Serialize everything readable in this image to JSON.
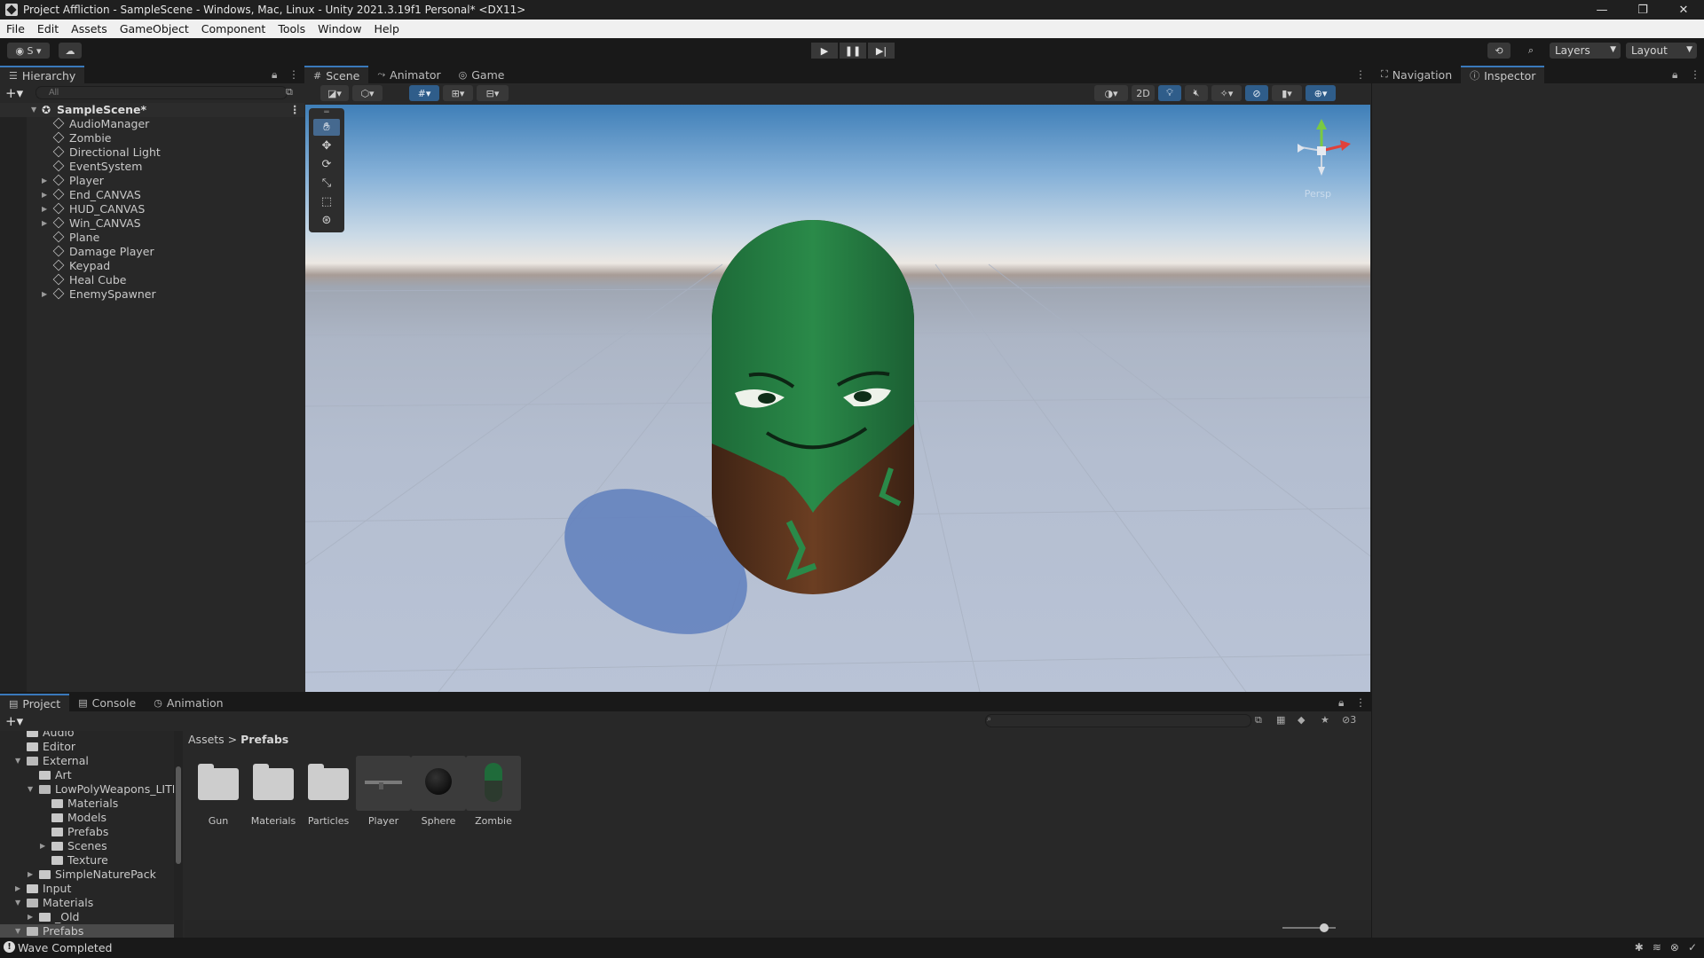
{
  "window": {
    "title": "Project Affliction - SampleScene - Windows, Mac, Linux - Unity 2021.3.19f1 Personal* <DX11>",
    "controls": [
      "—",
      "❐",
      "✕"
    ]
  },
  "menu": [
    "File",
    "Edit",
    "Assets",
    "GameObject",
    "Component",
    "Tools",
    "Window",
    "Help"
  ],
  "toolbar": {
    "account_label": "S",
    "layers_label": "Layers",
    "layout_label": "Layout"
  },
  "hierarchy": {
    "tab_label": "Hierarchy",
    "search_placeholder": "All",
    "scene_name": "SampleScene*",
    "items": [
      {
        "label": "AudioManager",
        "expandable": false
      },
      {
        "label": "Zombie",
        "expandable": false
      },
      {
        "label": "Directional Light",
        "expandable": false
      },
      {
        "label": "EventSystem",
        "expandable": false
      },
      {
        "label": "Player",
        "expandable": true
      },
      {
        "label": "End_CANVAS",
        "expandable": true
      },
      {
        "label": "HUD_CANVAS",
        "expandable": true
      },
      {
        "label": "Win_CANVAS",
        "expandable": true
      },
      {
        "label": "Plane",
        "expandable": false
      },
      {
        "label": "Damage Player",
        "expandable": false
      },
      {
        "label": "Keypad",
        "expandable": false
      },
      {
        "label": "Heal Cube",
        "expandable": false
      },
      {
        "label": "EnemySpawner",
        "expandable": true
      }
    ]
  },
  "scene_tabs": [
    {
      "label": "Scene",
      "icon": "#",
      "active": true
    },
    {
      "label": "Animator",
      "icon": "⤳",
      "active": false
    },
    {
      "label": "Game",
      "icon": "◎",
      "active": false
    }
  ],
  "scene_toolbar": {
    "mode_2d_label": "2D"
  },
  "scene_view": {
    "persp_label": "Persp",
    "gizmo_axes": {
      "y_color": "#7ac943",
      "x_color": "#e0413a",
      "z_color": "#4a7fd8"
    }
  },
  "right_tabs": [
    {
      "label": "Navigation",
      "icon": "⛶",
      "active": false
    },
    {
      "label": "Inspector",
      "icon": "ⓘ",
      "active": true
    }
  ],
  "bottom_tabs": [
    {
      "label": "Project",
      "icon": "▤",
      "active": true
    },
    {
      "label": "Console",
      "icon": "▤",
      "active": false
    },
    {
      "label": "Animation",
      "icon": "◷",
      "active": false
    }
  ],
  "project": {
    "search_value": "",
    "hidden_count": "3",
    "tree": [
      {
        "label": "Audio",
        "indent": 1,
        "arrow": "",
        "selected": false
      },
      {
        "label": "Editor",
        "indent": 1,
        "arrow": "",
        "selected": false
      },
      {
        "label": "External",
        "indent": 1,
        "arrow": "▼",
        "selected": false
      },
      {
        "label": "Art",
        "indent": 2,
        "arrow": "",
        "selected": false
      },
      {
        "label": "LowPolyWeapons_LITE",
        "indent": 2,
        "arrow": "▼",
        "selected": false
      },
      {
        "label": "Materials",
        "indent": 3,
        "arrow": "",
        "selected": false
      },
      {
        "label": "Models",
        "indent": 3,
        "arrow": "",
        "selected": false
      },
      {
        "label": "Prefabs",
        "indent": 3,
        "arrow": "",
        "selected": false
      },
      {
        "label": "Scenes",
        "indent": 3,
        "arrow": "▶",
        "selected": false
      },
      {
        "label": "Texture",
        "indent": 3,
        "arrow": "",
        "selected": false
      },
      {
        "label": "SimpleNaturePack",
        "indent": 2,
        "arrow": "▶",
        "selected": false
      },
      {
        "label": "Input",
        "indent": 1,
        "arrow": "▶",
        "selected": false
      },
      {
        "label": "Materials",
        "indent": 1,
        "arrow": "▼",
        "selected": false
      },
      {
        "label": "_Old",
        "indent": 2,
        "arrow": "▶",
        "selected": false
      },
      {
        "label": "Prefabs",
        "indent": 1,
        "arrow": "▼",
        "selected": true
      }
    ],
    "breadcrumb_root": "Assets",
    "breadcrumb_sep": ">",
    "breadcrumb_current": "Prefabs",
    "assets": [
      {
        "name": "Gun",
        "kind": "folder"
      },
      {
        "name": "Materials",
        "kind": "folder"
      },
      {
        "name": "Particles",
        "kind": "folder"
      },
      {
        "name": "Player",
        "kind": "prefab-gun"
      },
      {
        "name": "Sphere",
        "kind": "prefab-sphere"
      },
      {
        "name": "Zombie",
        "kind": "prefab-zombie"
      }
    ]
  },
  "status": {
    "message": "Wave Completed"
  }
}
